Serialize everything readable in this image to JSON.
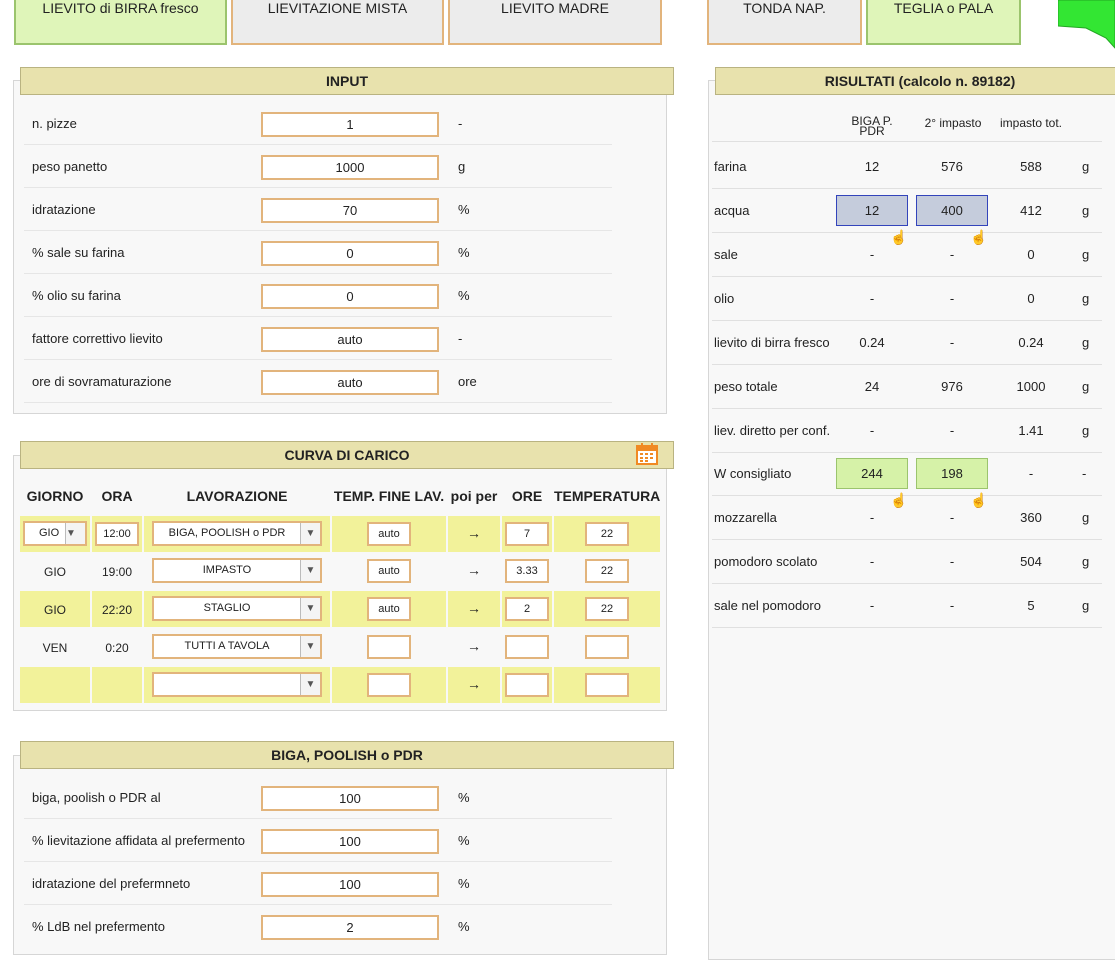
{
  "tabs": [
    {
      "label": "LIEVITO di BIRRA fresco",
      "style": "green"
    },
    {
      "label": "LIEVITAZIONE MISTA",
      "style": "gray"
    },
    {
      "label": "LIEVITO MADRE",
      "style": "gray"
    },
    {
      "label": "TONDA NAP.",
      "style": "gray"
    },
    {
      "label": "TEGLIA o PALA",
      "style": "green"
    }
  ],
  "input": {
    "title": "INPUT",
    "rows": [
      {
        "label": "n. pizze",
        "value": "1",
        "unit": "-"
      },
      {
        "label": "peso panetto",
        "value": "1000",
        "unit": "g"
      },
      {
        "label": "idratazione",
        "value": "70",
        "unit": "%"
      },
      {
        "label": "% sale su farina",
        "value": "0",
        "unit": "%"
      },
      {
        "label": "% olio su farina",
        "value": "0",
        "unit": "%"
      },
      {
        "label": "fattore correttivo lievito",
        "value": "auto",
        "unit": "-"
      },
      {
        "label": "ore di sovramaturazione",
        "value": "auto",
        "unit": "ore"
      }
    ]
  },
  "results": {
    "title": "RISULTATI (calcolo n. 89182)",
    "columns": [
      "BIGA P. PDR",
      "2° impasto",
      "impasto tot."
    ],
    "rows": [
      {
        "label": "farina",
        "c1": "12",
        "c2": "576",
        "c3": "588",
        "unit": "g"
      },
      {
        "label": "acqua",
        "c1": "12",
        "c2": "400",
        "c3": "412",
        "unit": "g"
      },
      {
        "label": "sale",
        "c1": "-",
        "c2": "-",
        "c3": "0",
        "unit": "g"
      },
      {
        "label": "olio",
        "c1": "-",
        "c2": "-",
        "c3": "0",
        "unit": "g"
      },
      {
        "label": "lievito di birra fresco",
        "c1": "0.24",
        "c2": "-",
        "c3": "0.24",
        "unit": "g"
      },
      {
        "label": "peso totale",
        "c1": "24",
        "c2": "976",
        "c3": "1000",
        "unit": "g"
      },
      {
        "label": "liev. diretto per conf.",
        "c1": "-",
        "c2": "-",
        "c3": "1.41",
        "unit": "g"
      },
      {
        "label": "W consigliato",
        "c1": "244",
        "c2": "198",
        "c3": "-",
        "unit": "-"
      },
      {
        "label": "mozzarella",
        "c1": "-",
        "c2": "-",
        "c3": "360",
        "unit": "g"
      },
      {
        "label": "pomodoro scolato",
        "c1": "-",
        "c2": "-",
        "c3": "504",
        "unit": "g"
      },
      {
        "label": "sale nel pomodoro",
        "c1": "-",
        "c2": "-",
        "c3": "5",
        "unit": "g"
      }
    ]
  },
  "curve": {
    "title": "CURVA DI CARICO",
    "headers": [
      "GIORNO",
      "ORA",
      "LAVORAZIONE",
      "TEMP. FINE LAV.",
      "poi per",
      "ORE",
      "TEMPERATURA"
    ],
    "rows": [
      {
        "giorno": "GIO",
        "ora": "12:00",
        "lavorazione": "BIGA, POOLISH o PDR",
        "temp_fine": "auto",
        "arrow": "→",
        "ore": "7",
        "temperatura": "22"
      },
      {
        "giorno": "GIO",
        "ora": "19:00",
        "lavorazione": "IMPASTO",
        "temp_fine": "auto",
        "arrow": "→",
        "ore": "3.33",
        "temperatura": "22"
      },
      {
        "giorno": "GIO",
        "ora": "22:20",
        "lavorazione": "STAGLIO",
        "temp_fine": "auto",
        "arrow": "→",
        "ore": "2",
        "temperatura": "22"
      },
      {
        "giorno": "VEN",
        "ora": "0:20",
        "lavorazione": "TUTTI A TAVOLA",
        "temp_fine": "",
        "arrow": "→",
        "ore": "",
        "temperatura": ""
      },
      {
        "giorno": "",
        "ora": "",
        "lavorazione": "",
        "temp_fine": "",
        "arrow": "→",
        "ore": "",
        "temperatura": ""
      }
    ]
  },
  "biga": {
    "title": "BIGA, POOLISH o PDR",
    "rows": [
      {
        "label": "biga, poolish o PDR al",
        "value": "100",
        "unit": "%"
      },
      {
        "label": "% lievitazione affidata al prefermento",
        "value": "100",
        "unit": "%"
      },
      {
        "label": "idratazione del prefermneto",
        "value": "100",
        "unit": "%"
      },
      {
        "label": "% LdB nel prefermento",
        "value": "2",
        "unit": "%"
      }
    ]
  },
  "colors": {
    "header": "#e8e2ad",
    "input_border": "#e2b47c",
    "highlight_row": "#f2f29a",
    "result_blue": "#c5ccdc",
    "result_green": "#d6f2a8",
    "calendar_icon": "#f08a24"
  },
  "icons": {
    "calendar": "calendar-icon",
    "hand": "hand-pointer-icon",
    "flag": "green-flag-icon"
  }
}
